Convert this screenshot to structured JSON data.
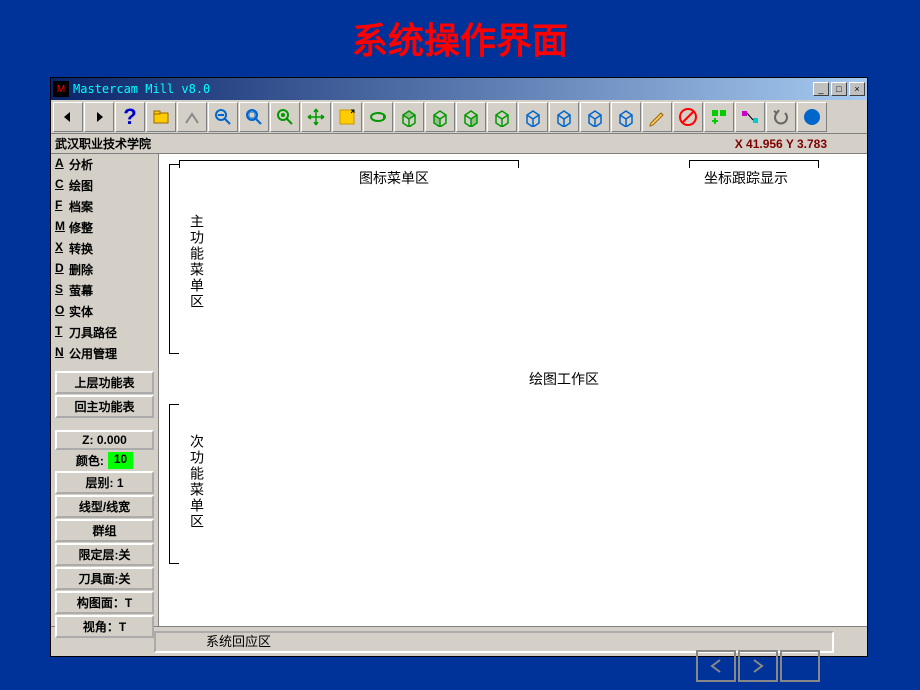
{
  "slide_title": "系统操作界面",
  "window": {
    "title": "Mastercam Mill v8.0",
    "icon_text": "M"
  },
  "statusbar": {
    "left": "武汉职业技术学院",
    "coords": "X 41.956  Y 3.783"
  },
  "menu_items": [
    {
      "key": "A",
      "label": "分析"
    },
    {
      "key": "C",
      "label": "绘图"
    },
    {
      "key": "F",
      "label": "档案"
    },
    {
      "key": "M",
      "label": "修整"
    },
    {
      "key": "X",
      "label": "转换"
    },
    {
      "key": "D",
      "label": "删除"
    },
    {
      "key": "S",
      "label": "萤幕"
    },
    {
      "key": "O",
      "label": "实体"
    },
    {
      "key": "T",
      "label": "刀具路径"
    },
    {
      "key": "N",
      "label": "公用管理"
    }
  ],
  "nav_buttons": {
    "up": "上层功能表",
    "home": "回主功能表"
  },
  "settings": {
    "z_label": "Z:",
    "z_value": "0.000",
    "color_label": "颜色:",
    "color_value": "10",
    "layer": "层别: 1",
    "linetype": "线型/线宽",
    "group": "群组",
    "limit_layer": "限定层:关",
    "tool_face": "刀具面:关",
    "construct_plane": "构图面：T",
    "view": "视角：T"
  },
  "annotations": {
    "toolbar_area": "图标菜单区",
    "coord_display": "坐标跟踪显示",
    "main_menu": "主功能菜单区",
    "sub_menu": "次功能菜单区",
    "workspace": "绘图工作区",
    "response": "系统回应区"
  },
  "toolbar_icons": [
    "arrow-left",
    "arrow-right",
    "help",
    "open",
    "analyze",
    "zoom-out",
    "zoom-fit",
    "zoom-target",
    "pan",
    "zoom-window",
    "rotate",
    "view-top",
    "view-front",
    "view-side",
    "view-iso",
    "view-3d-1",
    "view-3d-2",
    "view-3d-3",
    "view-3d-4",
    "pencil",
    "delete",
    "regen",
    "toolpath",
    "undo",
    "run"
  ]
}
